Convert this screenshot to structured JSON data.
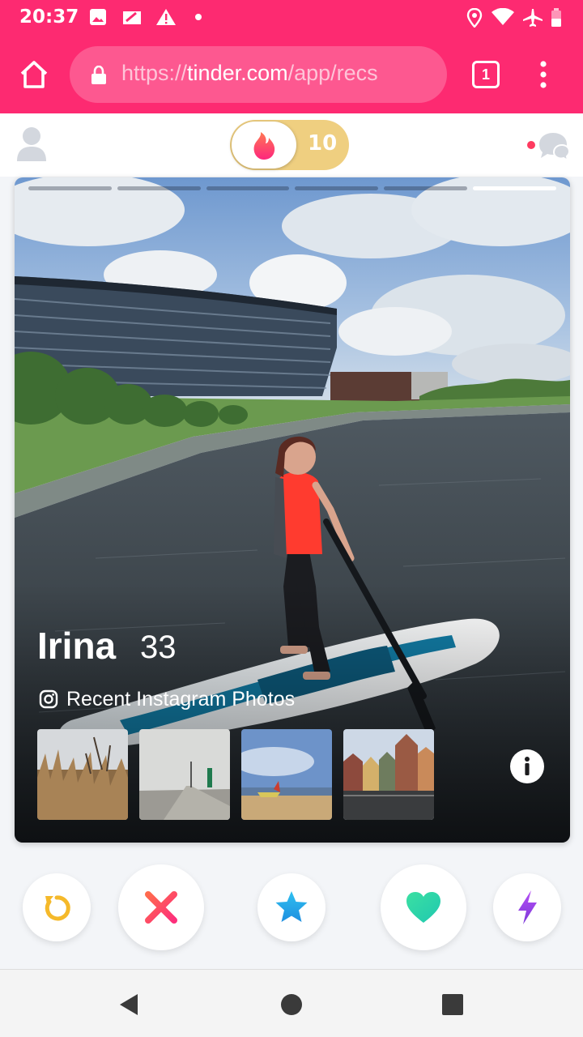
{
  "status_bar": {
    "time": "20:37",
    "background": "#fd2a71",
    "icons": [
      "image-icon",
      "sim-icon",
      "warning-icon",
      "dot-icon",
      "location-icon",
      "wifi-icon",
      "airplane-icon",
      "battery-icon"
    ]
  },
  "browser": {
    "url_scheme": "https://",
    "url_host": "tinder.com",
    "url_path": "/app/recs",
    "tab_count": "1",
    "icons": [
      "home-icon",
      "lock-icon",
      "tabs-icon",
      "overflow-menu-icon"
    ]
  },
  "header": {
    "boost_count": "10",
    "boost_color": "#efcf80",
    "icons": [
      "profile-icon",
      "flame-icon",
      "chat-icon"
    ]
  },
  "card": {
    "name": "Irina",
    "age": "33",
    "instagram_label": "Recent Instagram Photos",
    "photo_count": 6,
    "active_photo_index": 5,
    "thumbnails": [
      "thumb-grasses",
      "thumb-pier",
      "thumb-beach",
      "thumb-townhouses"
    ],
    "icons": [
      "instagram-icon",
      "info-icon"
    ]
  },
  "actions": {
    "buttons": [
      "rewind",
      "nope",
      "super-like",
      "like",
      "boost"
    ],
    "colors": {
      "rewind": "#f5b92a",
      "nope": "#fe4b63",
      "super_like": "#2ea6ea",
      "like": "#2dd9a4",
      "boost": "#9b46e4"
    }
  },
  "nav_bar": {
    "icons": [
      "back-icon",
      "home-circle-icon",
      "recents-icon"
    ]
  }
}
